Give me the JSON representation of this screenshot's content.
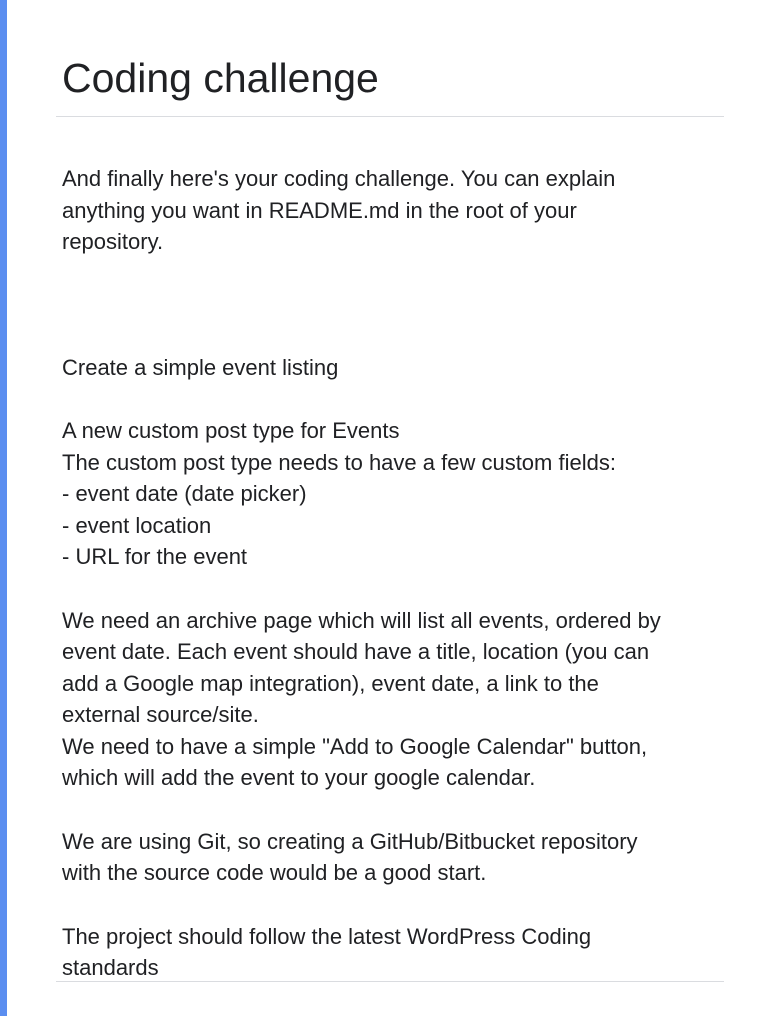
{
  "form": {
    "title": "Coding challenge",
    "intro": "And finally here's your coding challenge. You can explain\nanything you want in README.md in the root of your\nrepository.",
    "heading": "Create a simple event listing",
    "requirements": "A new custom post type for Events\nThe custom post type needs to have a few custom fields:\n- event date (date picker)\n- event location\n- URL for the event",
    "archive": "We need an archive page which will list all events, ordered by\nevent date. Each event should have a title, location (you can\nadd a Google map integration), event date, a link to the\nexternal source/site.\nWe need to have a simple \"Add to Google Calendar\" button,\nwhich will add the event to your google calendar.",
    "git": "We are using Git, so creating a GitHub/Bitbucket repository\nwith the source code would be a good start.",
    "standards": "The project should follow the latest WordPress Coding\nstandards"
  },
  "colors": {
    "accent": "#5b8ef0",
    "text": "#202124",
    "divider": "#dadce0"
  }
}
